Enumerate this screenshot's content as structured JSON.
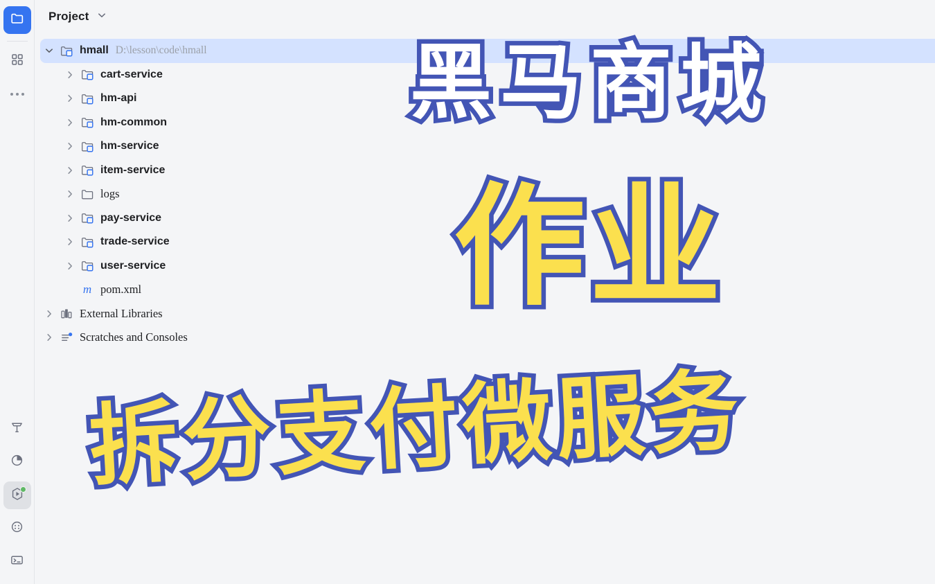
{
  "window": {
    "background_color": "#f4f5f7",
    "accent_blue": "#3574f0",
    "selection_color": "#d4e2ff"
  },
  "activity_bar": {
    "top_items": [
      {
        "name": "project-tool-window",
        "icon": "folder-icon",
        "state": "active-primary"
      },
      {
        "name": "structure-tool-window",
        "icon": "grid-squares-icon",
        "state": "normal"
      },
      {
        "name": "more-tool-windows",
        "icon": "ellipsis-icon",
        "state": "normal"
      }
    ],
    "bottom_items": [
      {
        "name": "build-tool-window",
        "icon": "hammer-icon",
        "state": "normal"
      },
      {
        "name": "profiler-tool-window",
        "icon": "pie-chart-icon",
        "state": "normal"
      },
      {
        "name": "services-run-tool-window",
        "icon": "run-play-icon",
        "state": "active",
        "badge": "green-dot"
      },
      {
        "name": "endpoints-tool-window",
        "icon": "dotted-circle-icon",
        "state": "normal"
      },
      {
        "name": "terminal-tool-window",
        "icon": "terminal-icon",
        "state": "normal"
      }
    ]
  },
  "header": {
    "title": "Project",
    "dropdown_icon": "chevron-down-icon"
  },
  "tree": {
    "root": {
      "label": "hmall",
      "path": "D:\\lesson\\code\\hmall",
      "icon": "maven-module-folder-icon",
      "twisty": "chevron-expanded-icon",
      "selected": true,
      "bold": true
    },
    "children": [
      {
        "label": "cart-service",
        "icon": "maven-module-folder-icon",
        "twisty": "chevron-collapsed-icon",
        "bold": true,
        "indent": 1
      },
      {
        "label": "hm-api",
        "icon": "maven-module-folder-icon",
        "twisty": "chevron-collapsed-icon",
        "bold": true,
        "indent": 1
      },
      {
        "label": "hm-common",
        "icon": "maven-module-folder-icon",
        "twisty": "chevron-collapsed-icon",
        "bold": true,
        "indent": 1
      },
      {
        "label": "hm-service",
        "icon": "maven-module-folder-icon",
        "twisty": "chevron-collapsed-icon",
        "bold": true,
        "indent": 1
      },
      {
        "label": "item-service",
        "icon": "maven-module-folder-icon",
        "twisty": "chevron-collapsed-icon",
        "bold": true,
        "indent": 1
      },
      {
        "label": "logs",
        "icon": "plain-folder-icon",
        "twisty": "chevron-collapsed-icon",
        "bold": false,
        "indent": 1
      },
      {
        "label": "pay-service",
        "icon": "maven-module-folder-icon",
        "twisty": "chevron-collapsed-icon",
        "bold": true,
        "indent": 1
      },
      {
        "label": "trade-service",
        "icon": "maven-module-folder-icon",
        "twisty": "chevron-collapsed-icon",
        "bold": true,
        "indent": 1
      },
      {
        "label": "user-service",
        "icon": "maven-module-folder-icon",
        "twisty": "chevron-collapsed-icon",
        "bold": true,
        "indent": 1
      },
      {
        "label": "pom.xml",
        "icon": "maven-pom-icon",
        "twisty": "none",
        "bold": false,
        "indent": 1
      }
    ],
    "footer_nodes": [
      {
        "label": "External Libraries",
        "icon": "libraries-icon",
        "twisty": "chevron-collapsed-icon",
        "indent": 0
      },
      {
        "label": "Scratches and Consoles",
        "icon": "scratches-icon",
        "twisty": "chevron-collapsed-icon",
        "indent": 0
      }
    ]
  },
  "overlay": {
    "title_text": "黑马商城",
    "subtitle_text": "作业",
    "footer_text": "拆分支付微服务",
    "outline_color": "#4355b5",
    "title_fill_color": "#ffffff",
    "body_fill_color": "#fbe04e"
  }
}
